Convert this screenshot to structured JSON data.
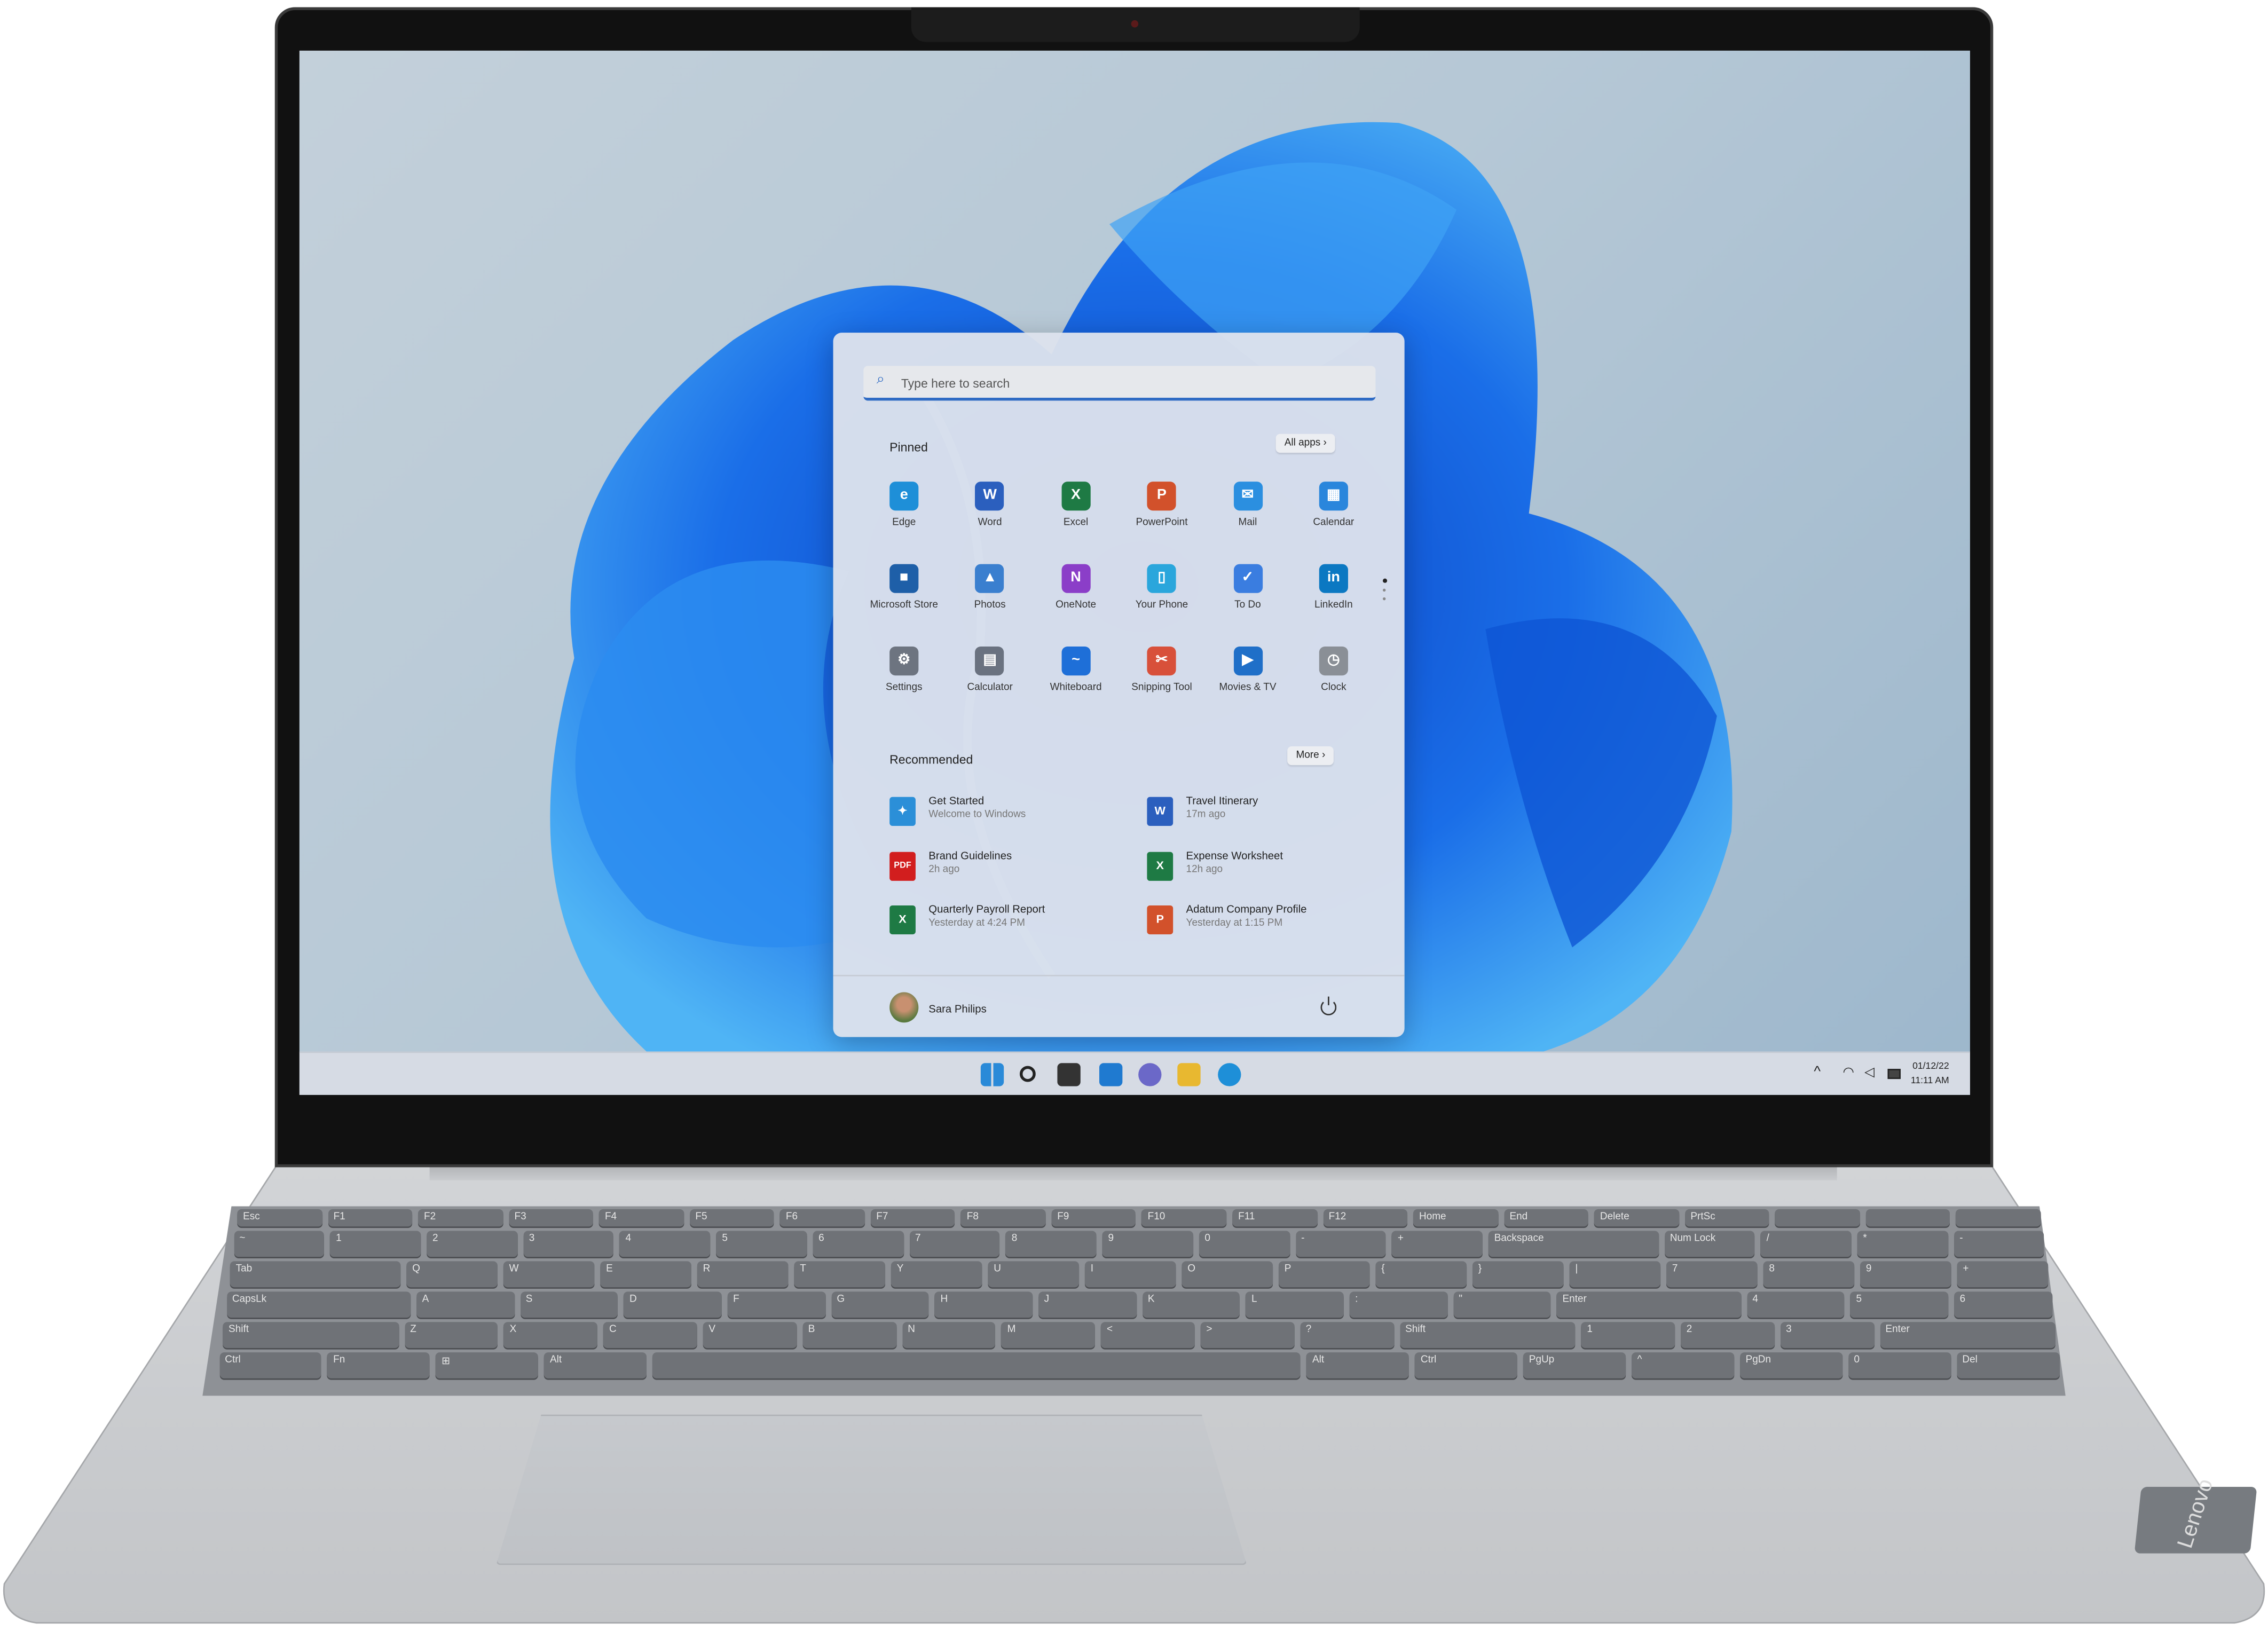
{
  "start_menu": {
    "search_placeholder": "Type here to search",
    "pinned_label": "Pinned",
    "all_apps_label": "All apps",
    "pinned": [
      {
        "name": "Edge",
        "icon": "edge-icon",
        "color": "#1e8fd8",
        "glyph": "e"
      },
      {
        "name": "Word",
        "icon": "word-icon",
        "color": "#2b5fbe",
        "glyph": "W"
      },
      {
        "name": "Excel",
        "icon": "excel-icon",
        "color": "#1e7a44",
        "glyph": "X"
      },
      {
        "name": "PowerPoint",
        "icon": "powerpoint-icon",
        "color": "#d2512b",
        "glyph": "P"
      },
      {
        "name": "Mail",
        "icon": "mail-icon",
        "color": "#2b8fe0",
        "glyph": "✉"
      },
      {
        "name": "Calendar",
        "icon": "calendar-icon",
        "color": "#2a86dc",
        "glyph": "▦"
      },
      {
        "name": "Microsoft Store",
        "icon": "store-icon",
        "color": "#1e5fa8",
        "glyph": "■"
      },
      {
        "name": "Photos",
        "icon": "photos-icon",
        "color": "#3a7fcf",
        "glyph": "▲"
      },
      {
        "name": "OneNote",
        "icon": "onenote-icon",
        "color": "#8b3ec8",
        "glyph": "N"
      },
      {
        "name": "Your Phone",
        "icon": "phone-icon",
        "color": "#2aa6dc",
        "glyph": "▯"
      },
      {
        "name": "To Do",
        "icon": "todo-icon",
        "color": "#3a7de0",
        "glyph": "✓"
      },
      {
        "name": "LinkedIn",
        "icon": "linkedin-icon",
        "color": "#0b78c2",
        "glyph": "in"
      },
      {
        "name": "Settings",
        "icon": "gear-icon",
        "color": "#6d7480",
        "glyph": "⚙"
      },
      {
        "name": "Calculator",
        "icon": "calculator-icon",
        "color": "#6a7280",
        "glyph": "▤"
      },
      {
        "name": "Whiteboard",
        "icon": "whiteboard-icon",
        "color": "#1e6fd8",
        "glyph": "~"
      },
      {
        "name": "Snipping Tool",
        "icon": "scissors-icon",
        "color": "#d8503a",
        "glyph": "✂"
      },
      {
        "name": "Movies & TV",
        "icon": "movies-icon",
        "color": "#1f6fc8",
        "glyph": "▶"
      },
      {
        "name": "Clock",
        "icon": "clock-icon",
        "color": "#8a8f96",
        "glyph": "◷"
      }
    ],
    "recommended_label": "Recommended",
    "more_label": "More",
    "recommended": [
      {
        "title": "Get Started",
        "sub": "Welcome to Windows",
        "icon": "get-started-icon",
        "color": "#2b8fd8",
        "glyph": "✦"
      },
      {
        "title": "Travel Itinerary",
        "sub": "17m ago",
        "icon": "word-file-icon",
        "color": "#2b5fbe",
        "glyph": "W"
      },
      {
        "title": "Brand Guidelines",
        "sub": "2h ago",
        "icon": "pdf-file-icon",
        "color": "#d21e1e",
        "glyph": "PDF"
      },
      {
        "title": "Expense Worksheet",
        "sub": "12h ago",
        "icon": "excel-file-icon",
        "color": "#1e7a44",
        "glyph": "X"
      },
      {
        "title": "Quarterly Payroll Report",
        "sub": "Yesterday at 4:24 PM",
        "icon": "excel-file-icon",
        "color": "#1e7a44",
        "glyph": "X"
      },
      {
        "title": "Adatum Company Profile",
        "sub": "Yesterday at 1:15 PM",
        "icon": "powerpoint-file-icon",
        "color": "#d2512b",
        "glyph": "P"
      }
    ],
    "user_name": "Sara Philips"
  },
  "taskbar": {
    "icons": [
      {
        "name": "start-icon",
        "color": "#2a8ad8"
      },
      {
        "name": "search-icon",
        "color": "#222"
      },
      {
        "name": "task-view-icon",
        "color": "#333"
      },
      {
        "name": "widgets-icon",
        "color": "#1f7ad0"
      },
      {
        "name": "teams-chat-icon",
        "color": "#6b68c8"
      },
      {
        "name": "file-explorer-icon",
        "color": "#e8b830"
      },
      {
        "name": "edge-icon",
        "color": "#1e8fd8"
      }
    ],
    "date": "01/12/22",
    "time": "11:11 AM"
  },
  "keyboard": {
    "rows": [
      [
        "Esc",
        "F1",
        "F2",
        "F3",
        "F4",
        "F5",
        "F6",
        "F7",
        "F8",
        "F9",
        "F10",
        "F11",
        "F12",
        "Home",
        "End",
        "Delete",
        "PrtSc",
        "",
        "",
        ""
      ],
      [
        "~",
        "1",
        "2",
        "3",
        "4",
        "5",
        "6",
        "7",
        "8",
        "9",
        "0",
        "-",
        "+",
        "Backspace",
        "Num Lock",
        "/",
        "*",
        "-"
      ],
      [
        "Tab",
        "Q",
        "W",
        "E",
        "R",
        "T",
        "Y",
        "U",
        "I",
        "O",
        "P",
        "{",
        "}",
        "|",
        "7",
        "8",
        "9",
        "+"
      ],
      [
        "CapsLk",
        "A",
        "S",
        "D",
        "F",
        "G",
        "H",
        "J",
        "K",
        "L",
        ":",
        "\"",
        "Enter",
        "4",
        "5",
        "6"
      ],
      [
        "Shift",
        "Z",
        "X",
        "C",
        "V",
        "B",
        "N",
        "M",
        "<",
        ">",
        "?",
        "Shift",
        "1",
        "2",
        "3",
        "Enter"
      ],
      [
        "Ctrl",
        "Fn",
        "⊞",
        "Alt",
        "",
        "Alt",
        "Ctrl",
        "PgUp",
        "^",
        "PgDn",
        "0",
        "Del"
      ]
    ]
  },
  "brand": "Lenovo"
}
